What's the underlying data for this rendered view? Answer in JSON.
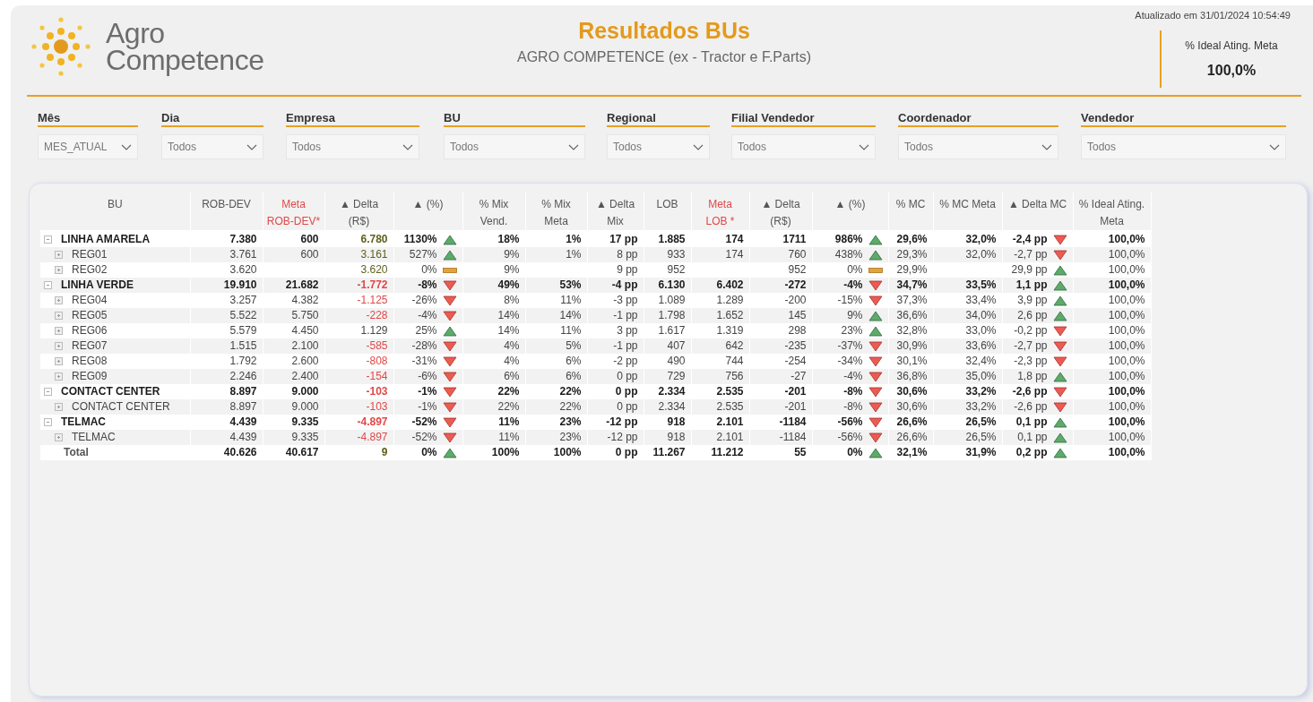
{
  "logo": {
    "line1": "Agro",
    "line2": "Competence"
  },
  "header": {
    "title": "Resultados BUs",
    "subtitle": "AGRO COMPETENCE (ex - Tractor e F.Parts)",
    "updated": "Atualizado em 31/01/2024 10:54:49"
  },
  "kpi": {
    "label": "% Ideal Ating. Meta",
    "value": "100,0%"
  },
  "filters": [
    {
      "label": "Mês",
      "value": "MES_ATUAL"
    },
    {
      "label": "Dia",
      "value": "Todos"
    },
    {
      "label": "Empresa",
      "value": "Todos"
    },
    {
      "label": "BU",
      "value": "Todos"
    },
    {
      "label": "Regional",
      "value": "Todos"
    },
    {
      "label": "Filial Vendedor",
      "value": "Todos"
    },
    {
      "label": "Coordenador",
      "value": "Todos"
    },
    {
      "label": "Vendedor",
      "value": "Todos"
    }
  ],
  "table": {
    "columns": [
      {
        "label": "BU",
        "color": "#555555"
      },
      {
        "label": "ROB-DEV",
        "color": "#555555"
      },
      {
        "label": "Meta\nROB-DEV*",
        "color": "#e04848"
      },
      {
        "label": "▲ Delta\n(R$)",
        "color": "#555555"
      },
      {
        "label": "▲ (%)",
        "color": "#555555"
      },
      {
        "label": "% Mix\nVend.",
        "color": "#555555"
      },
      {
        "label": "% Mix\nMeta",
        "color": "#555555"
      },
      {
        "label": "▲ Delta\nMix",
        "color": "#555555"
      },
      {
        "label": "LOB",
        "color": "#555555"
      },
      {
        "label": "Meta\nLOB *",
        "color": "#e04848"
      },
      {
        "label": "▲ Delta\n(R$)",
        "color": "#555555"
      },
      {
        "label": "▲ (%)",
        "color": "#555555"
      },
      {
        "label": "% MC",
        "color": "#555555"
      },
      {
        "label": "% MC Meta",
        "color": "#555555"
      },
      {
        "label": "▲ Delta MC",
        "color": "#555555"
      },
      {
        "label": "% Ideal Ating.\nMeta",
        "color": "#555555"
      }
    ],
    "rows": [
      {
        "kind": "group",
        "expanded": true,
        "cells": [
          {
            "text": "LINHA AMARELA"
          },
          {
            "text": "7.380"
          },
          {
            "text": "600"
          },
          {
            "text": "6.780",
            "color": "#5f5f1c"
          },
          {
            "text": "1130%",
            "kind": "up"
          },
          {
            "text": "18%"
          },
          {
            "text": "1%"
          },
          {
            "text": "17 pp"
          },
          {
            "text": "1.885"
          },
          {
            "text": "174"
          },
          {
            "text": "1711"
          },
          {
            "text": "986%",
            "kind": "up"
          },
          {
            "text": "29,6%"
          },
          {
            "text": "32,0%"
          },
          {
            "text": "-2,4 pp",
            "kind": "down"
          },
          {
            "text": "100,0%"
          }
        ]
      },
      {
        "kind": "child",
        "expanded": false,
        "cells": [
          {
            "text": "REG01"
          },
          {
            "text": "3.761"
          },
          {
            "text": "600"
          },
          {
            "text": "3.161",
            "color": "#5f5f1c"
          },
          {
            "text": "527%",
            "kind": "up"
          },
          {
            "text": "9%"
          },
          {
            "text": "1%"
          },
          {
            "text": "8 pp"
          },
          {
            "text": "933"
          },
          {
            "text": "174"
          },
          {
            "text": "760"
          },
          {
            "text": "438%",
            "kind": "up"
          },
          {
            "text": "29,3%"
          },
          {
            "text": "32,0%"
          },
          {
            "text": "-2,7 pp",
            "kind": "down"
          },
          {
            "text": "100,0%"
          }
        ]
      },
      {
        "kind": "child",
        "expanded": false,
        "cells": [
          {
            "text": "REG02"
          },
          {
            "text": "3.620"
          },
          {
            "text": ""
          },
          {
            "text": "3.620",
            "color": "#5f5f1c"
          },
          {
            "text": "0%",
            "kind": "flat"
          },
          {
            "text": "9%"
          },
          {
            "text": ""
          },
          {
            "text": "9 pp"
          },
          {
            "text": "952"
          },
          {
            "text": ""
          },
          {
            "text": "952"
          },
          {
            "text": "0%",
            "kind": "flat"
          },
          {
            "text": "29,9%"
          },
          {
            "text": ""
          },
          {
            "text": "29,9 pp",
            "kind": "up"
          },
          {
            "text": "100,0%"
          }
        ]
      },
      {
        "kind": "group",
        "expanded": true,
        "cells": [
          {
            "text": "LINHA VERDE"
          },
          {
            "text": "19.910"
          },
          {
            "text": "21.682"
          },
          {
            "text": "-1.772",
            "color": "#e04848"
          },
          {
            "text": "-8%",
            "kind": "down"
          },
          {
            "text": "49%"
          },
          {
            "text": "53%"
          },
          {
            "text": "-4 pp"
          },
          {
            "text": "6.130"
          },
          {
            "text": "6.402"
          },
          {
            "text": "-272"
          },
          {
            "text": "-4%",
            "kind": "down"
          },
          {
            "text": "34,7%"
          },
          {
            "text": "33,5%"
          },
          {
            "text": "1,1 pp",
            "kind": "up"
          },
          {
            "text": "100,0%"
          }
        ]
      },
      {
        "kind": "child",
        "expanded": false,
        "cells": [
          {
            "text": "REG04"
          },
          {
            "text": "3.257"
          },
          {
            "text": "4.382"
          },
          {
            "text": "-1.125",
            "color": "#e04848"
          },
          {
            "text": "-26%",
            "kind": "down"
          },
          {
            "text": "8%"
          },
          {
            "text": "11%"
          },
          {
            "text": "-3 pp"
          },
          {
            "text": "1.089"
          },
          {
            "text": "1.289"
          },
          {
            "text": "-200"
          },
          {
            "text": "-15%",
            "kind": "down"
          },
          {
            "text": "37,3%"
          },
          {
            "text": "33,4%"
          },
          {
            "text": "3,9 pp",
            "kind": "up"
          },
          {
            "text": "100,0%"
          }
        ]
      },
      {
        "kind": "child",
        "expanded": false,
        "cells": [
          {
            "text": "REG05"
          },
          {
            "text": "5.522"
          },
          {
            "text": "5.750"
          },
          {
            "text": "-228",
            "color": "#e04848"
          },
          {
            "text": "-4%",
            "kind": "down"
          },
          {
            "text": "14%"
          },
          {
            "text": "14%"
          },
          {
            "text": "-1 pp"
          },
          {
            "text": "1.798"
          },
          {
            "text": "1.652"
          },
          {
            "text": "145"
          },
          {
            "text": "9%",
            "kind": "up"
          },
          {
            "text": "36,6%"
          },
          {
            "text": "34,0%"
          },
          {
            "text": "2,6 pp",
            "kind": "up"
          },
          {
            "text": "100,0%"
          }
        ]
      },
      {
        "kind": "child",
        "expanded": false,
        "cells": [
          {
            "text": "REG06"
          },
          {
            "text": "5.579"
          },
          {
            "text": "4.450"
          },
          {
            "text": "1.129",
            "color": "#444444"
          },
          {
            "text": "25%",
            "kind": "up"
          },
          {
            "text": "14%"
          },
          {
            "text": "11%"
          },
          {
            "text": "3 pp"
          },
          {
            "text": "1.617"
          },
          {
            "text": "1.319"
          },
          {
            "text": "298"
          },
          {
            "text": "23%",
            "kind": "up"
          },
          {
            "text": "32,8%"
          },
          {
            "text": "33,0%"
          },
          {
            "text": "-0,2 pp",
            "kind": "down"
          },
          {
            "text": "100,0%"
          }
        ]
      },
      {
        "kind": "child",
        "expanded": false,
        "cells": [
          {
            "text": "REG07"
          },
          {
            "text": "1.515"
          },
          {
            "text": "2.100"
          },
          {
            "text": "-585",
            "color": "#e04848"
          },
          {
            "text": "-28%",
            "kind": "down"
          },
          {
            "text": "4%"
          },
          {
            "text": "5%"
          },
          {
            "text": "-1 pp"
          },
          {
            "text": "407"
          },
          {
            "text": "642"
          },
          {
            "text": "-235"
          },
          {
            "text": "-37%",
            "kind": "down"
          },
          {
            "text": "30,9%"
          },
          {
            "text": "33,6%"
          },
          {
            "text": "-2,7 pp",
            "kind": "down"
          },
          {
            "text": "100,0%"
          }
        ]
      },
      {
        "kind": "child",
        "expanded": false,
        "cells": [
          {
            "text": "REG08"
          },
          {
            "text": "1.792"
          },
          {
            "text": "2.600"
          },
          {
            "text": "-808",
            "color": "#e04848"
          },
          {
            "text": "-31%",
            "kind": "down"
          },
          {
            "text": "4%"
          },
          {
            "text": "6%"
          },
          {
            "text": "-2 pp"
          },
          {
            "text": "490"
          },
          {
            "text": "744"
          },
          {
            "text": "-254"
          },
          {
            "text": "-34%",
            "kind": "down"
          },
          {
            "text": "30,1%"
          },
          {
            "text": "32,4%"
          },
          {
            "text": "-2,3 pp",
            "kind": "down"
          },
          {
            "text": "100,0%"
          }
        ]
      },
      {
        "kind": "child",
        "expanded": false,
        "cells": [
          {
            "text": "REG09"
          },
          {
            "text": "2.246"
          },
          {
            "text": "2.400"
          },
          {
            "text": "-154",
            "color": "#e04848"
          },
          {
            "text": "-6%",
            "kind": "down"
          },
          {
            "text": "6%"
          },
          {
            "text": "6%"
          },
          {
            "text": "0 pp"
          },
          {
            "text": "729"
          },
          {
            "text": "756"
          },
          {
            "text": "-27"
          },
          {
            "text": "-4%",
            "kind": "down"
          },
          {
            "text": "36,8%"
          },
          {
            "text": "35,0%"
          },
          {
            "text": "1,8 pp",
            "kind": "up"
          },
          {
            "text": "100,0%"
          }
        ]
      },
      {
        "kind": "group",
        "expanded": true,
        "cells": [
          {
            "text": "CONTACT CENTER"
          },
          {
            "text": "8.897"
          },
          {
            "text": "9.000"
          },
          {
            "text": "-103",
            "color": "#e04848"
          },
          {
            "text": "-1%",
            "kind": "down"
          },
          {
            "text": "22%"
          },
          {
            "text": "22%"
          },
          {
            "text": "0 pp"
          },
          {
            "text": "2.334"
          },
          {
            "text": "2.535"
          },
          {
            "text": "-201"
          },
          {
            "text": "-8%",
            "kind": "down"
          },
          {
            "text": "30,6%"
          },
          {
            "text": "33,2%"
          },
          {
            "text": "-2,6 pp",
            "kind": "down"
          },
          {
            "text": "100,0%"
          }
        ]
      },
      {
        "kind": "child",
        "expanded": false,
        "cells": [
          {
            "text": "CONTACT CENTER"
          },
          {
            "text": "8.897"
          },
          {
            "text": "9.000"
          },
          {
            "text": "-103",
            "color": "#e04848"
          },
          {
            "text": "-1%",
            "kind": "down"
          },
          {
            "text": "22%"
          },
          {
            "text": "22%"
          },
          {
            "text": "0 pp"
          },
          {
            "text": "2.334"
          },
          {
            "text": "2.535"
          },
          {
            "text": "-201"
          },
          {
            "text": "-8%",
            "kind": "down"
          },
          {
            "text": "30,6%"
          },
          {
            "text": "33,2%"
          },
          {
            "text": "-2,6 pp",
            "kind": "down"
          },
          {
            "text": "100,0%"
          }
        ]
      },
      {
        "kind": "group",
        "expanded": true,
        "cells": [
          {
            "text": "TELMAC"
          },
          {
            "text": "4.439"
          },
          {
            "text": "9.335"
          },
          {
            "text": "-4.897",
            "color": "#e04848"
          },
          {
            "text": "-52%",
            "kind": "down"
          },
          {
            "text": "11%"
          },
          {
            "text": "23%"
          },
          {
            "text": "-12 pp"
          },
          {
            "text": "918"
          },
          {
            "text": "2.101"
          },
          {
            "text": "-1184"
          },
          {
            "text": "-56%",
            "kind": "down"
          },
          {
            "text": "26,6%"
          },
          {
            "text": "26,5%"
          },
          {
            "text": "0,1 pp",
            "kind": "up"
          },
          {
            "text": "100,0%"
          }
        ]
      },
      {
        "kind": "child",
        "expanded": false,
        "cells": [
          {
            "text": "TELMAC"
          },
          {
            "text": "4.439"
          },
          {
            "text": "9.335"
          },
          {
            "text": "-4.897",
            "color": "#e04848"
          },
          {
            "text": "-52%",
            "kind": "down"
          },
          {
            "text": "11%"
          },
          {
            "text": "23%"
          },
          {
            "text": "-12 pp"
          },
          {
            "text": "918"
          },
          {
            "text": "2.101"
          },
          {
            "text": "-1184"
          },
          {
            "text": "-56%",
            "kind": "down"
          },
          {
            "text": "26,6%"
          },
          {
            "text": "26,5%"
          },
          {
            "text": "0,1 pp",
            "kind": "up"
          },
          {
            "text": "100,0%"
          }
        ]
      },
      {
        "kind": "total",
        "cells": [
          {
            "text": "Total"
          },
          {
            "text": "40.626"
          },
          {
            "text": "40.617"
          },
          {
            "text": "9",
            "color": "#5f5f1c"
          },
          {
            "text": "0%",
            "kind": "up"
          },
          {
            "text": "100%"
          },
          {
            "text": "100%"
          },
          {
            "text": "0 pp"
          },
          {
            "text": "11.267"
          },
          {
            "text": "11.212"
          },
          {
            "text": "55"
          },
          {
            "text": "0%",
            "kind": "up"
          },
          {
            "text": "32,1%"
          },
          {
            "text": "31,9%"
          },
          {
            "text": "0,2 pp",
            "kind": "up"
          },
          {
            "text": "100,0%"
          }
        ]
      }
    ]
  }
}
